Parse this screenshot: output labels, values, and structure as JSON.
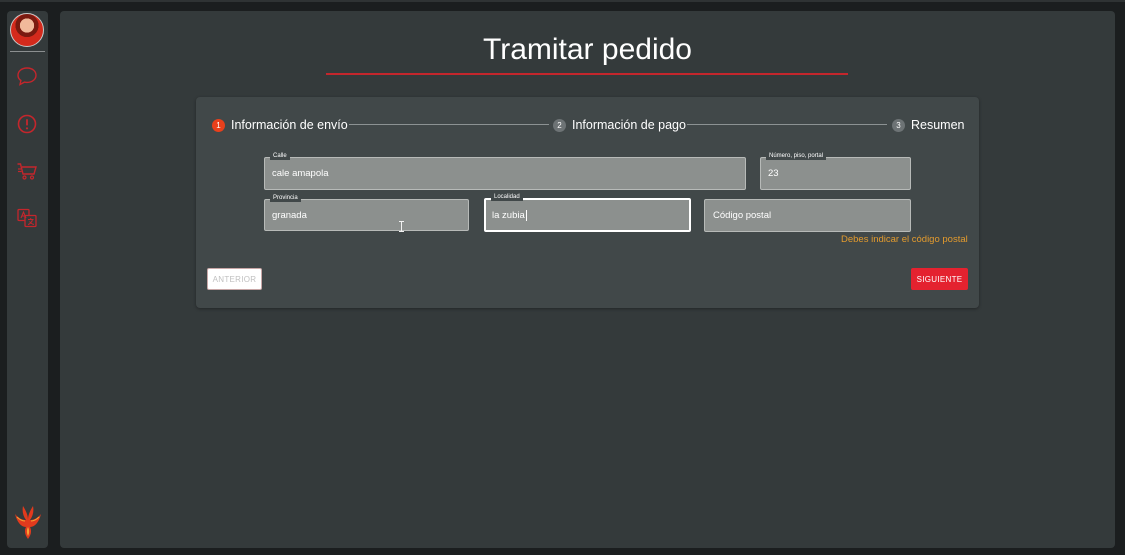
{
  "page": {
    "title": "Tramitar pedido"
  },
  "sidebar": {
    "items": [
      {
        "name": "chat",
        "icon": "chat-bubble-icon"
      },
      {
        "name": "alerts",
        "icon": "alert-circle-icon"
      },
      {
        "name": "cart",
        "icon": "cart-icon"
      },
      {
        "name": "translate",
        "icon": "translate-icon"
      }
    ],
    "logo_icon": "phoenix-logo-icon"
  },
  "stepper": {
    "steps": [
      {
        "number": "1",
        "label": "Información de envío",
        "active": true
      },
      {
        "number": "2",
        "label": "Información de pago",
        "active": false
      },
      {
        "number": "3",
        "label": "Resumen",
        "active": false
      }
    ]
  },
  "form": {
    "calle": {
      "label": "Calle",
      "value": "cale amapola"
    },
    "numero": {
      "label": "Número, piso, portal",
      "value": "23"
    },
    "provincia": {
      "label": "Provincia",
      "value": "granada"
    },
    "localidad": {
      "label": "Localidad",
      "value": "la zubia"
    },
    "codigo_postal": {
      "placeholder": "Código postal",
      "value": "",
      "error": "Debes indicar el código postal"
    }
  },
  "buttons": {
    "prev": "ANTERIOR",
    "next": "SIGUIENTE"
  },
  "colors": {
    "accent": "#c4262c",
    "active_step": "#e8401c",
    "error": "#e39b2e",
    "next_button": "#e4222f",
    "panel": "#414849",
    "background": "#343a3b"
  }
}
